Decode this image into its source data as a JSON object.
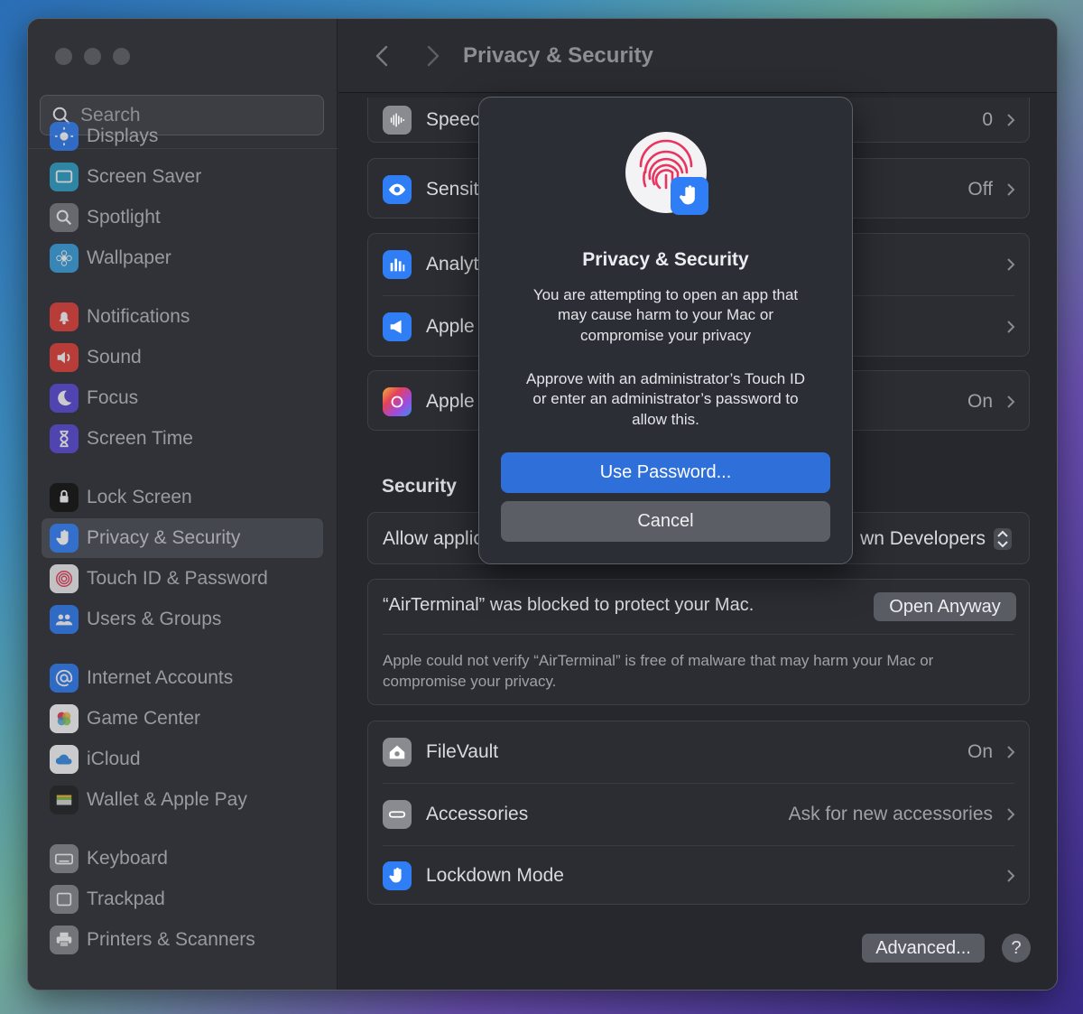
{
  "sidebar": {
    "search_placeholder": "Search",
    "items": [
      {
        "label": "Displays",
        "icon": "sun-icon",
        "color": "#2f7ef5"
      },
      {
        "label": "Screen Saver",
        "icon": "screensaver-icon",
        "color": "#2fa3c8"
      },
      {
        "label": "Spotlight",
        "icon": "magnifier-icon",
        "color": "#7b7c82"
      },
      {
        "label": "Wallpaper",
        "icon": "flower-icon",
        "color": "#3aa3e0"
      },
      {
        "label": "Notifications",
        "icon": "bell-icon",
        "color": "#e5413a"
      },
      {
        "label": "Sound",
        "icon": "speaker-icon",
        "color": "#e5413a"
      },
      {
        "label": "Focus",
        "icon": "moon-icon",
        "color": "#5a4ad8"
      },
      {
        "label": "Screen Time",
        "icon": "hourglass-icon",
        "color": "#5a4ad8"
      },
      {
        "label": "Lock Screen",
        "icon": "lock-icon",
        "color": "#111111"
      },
      {
        "label": "Privacy & Security",
        "icon": "hand-icon",
        "color": "#2f7ef5"
      },
      {
        "label": "Touch ID & Password",
        "icon": "fingerprint-icon",
        "color": "#f3f3f5"
      },
      {
        "label": "Users & Groups",
        "icon": "users-icon",
        "color": "#2f7ef5"
      },
      {
        "label": "Internet Accounts",
        "icon": "at-icon",
        "color": "#2f7ef5"
      },
      {
        "label": "Game Center",
        "icon": "gamecenter-icon",
        "color": "#ffffff"
      },
      {
        "label": "iCloud",
        "icon": "cloud-icon",
        "color": "#ffffff"
      },
      {
        "label": "Wallet & Apple Pay",
        "icon": "wallet-icon",
        "color": "#222222"
      },
      {
        "label": "Keyboard",
        "icon": "keyboard-icon",
        "color": "#8a8b90"
      },
      {
        "label": "Trackpad",
        "icon": "trackpad-icon",
        "color": "#8a8b90"
      },
      {
        "label": "Printers & Scanners",
        "icon": "printer-icon",
        "color": "#8a8b90"
      }
    ]
  },
  "header": {
    "title": "Privacy & Security"
  },
  "rows": {
    "speech": {
      "label": "Speec",
      "value": "0"
    },
    "sensitive": {
      "label": "Sensit",
      "value": "Off"
    },
    "analytics": {
      "label": "Analyt"
    },
    "apple_ads": {
      "label": "Apple"
    },
    "apple_intel": {
      "label": "Apple",
      "value": "On"
    }
  },
  "security": {
    "title": "Security",
    "allow_label": "Allow applic",
    "allow_value": "wn Developers",
    "blocked_text": "“AirTerminal” was blocked to protect your Mac.",
    "open_anyway": "Open Anyway",
    "blocked_detail_1": "Apple could not verify “AirTerminal” is free of malware that may harm your Mac or",
    "blocked_detail_2": "compromise your privacy.",
    "filevault": {
      "label": "FileVault",
      "value": "On"
    },
    "accessories": {
      "label": "Accessories",
      "value": "Ask for new accessories"
    },
    "lockdown": {
      "label": "Lockdown Mode"
    }
  },
  "footer": {
    "advanced": "Advanced...",
    "help": "?"
  },
  "dialog": {
    "title": "Privacy & Security",
    "line1": "You are attempting to open an app that",
    "line2": "may cause harm to your Mac or",
    "line3": "compromise your privacy",
    "line4": "Approve with an administrator’s Touch ID",
    "line5": "or enter an administrator’s password to",
    "line6": "allow this.",
    "use_password": "Use Password...",
    "cancel": "Cancel"
  },
  "colors": {
    "accent": "#2f6fd9",
    "window_bg": "#2a2c33"
  }
}
